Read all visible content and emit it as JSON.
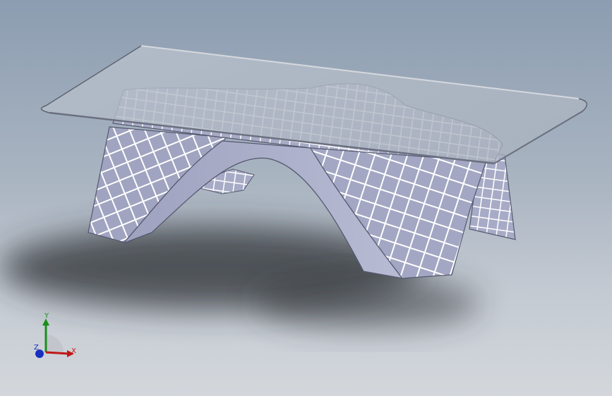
{
  "viewport": {
    "background_top": "#8c9db1",
    "background_bottom": "#d3d7dc"
  },
  "model": {
    "name": "glass-top-arch-lattice-table",
    "glass_color": "#b3bcc8",
    "shell_color": "#a3a7c3",
    "grid_color": "#ffffff",
    "shadow_color": "#2c2f33"
  },
  "triad": {
    "x_label": "X",
    "y_label": "Y",
    "z_label": "Z",
    "x_color": "#c01818",
    "y_color": "#1b8f1b",
    "z_color": "#1a2fbf"
  }
}
